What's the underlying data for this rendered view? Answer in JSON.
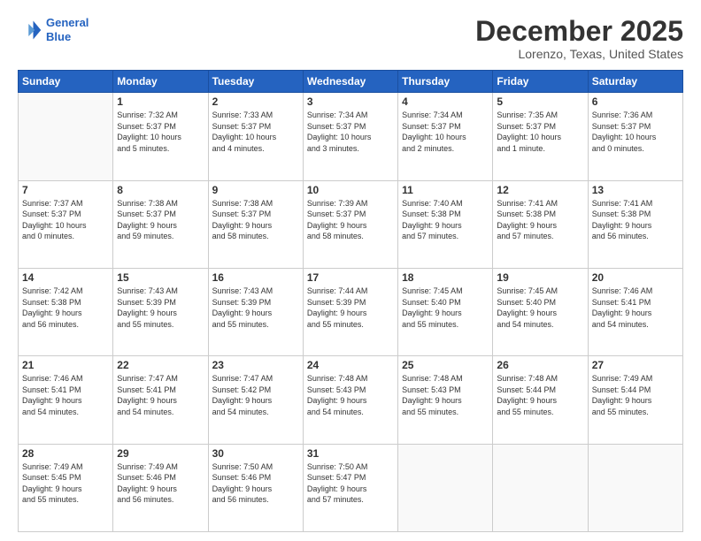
{
  "logo": {
    "line1": "General",
    "line2": "Blue"
  },
  "header": {
    "month": "December 2025",
    "location": "Lorenzo, Texas, United States"
  },
  "weekdays": [
    "Sunday",
    "Monday",
    "Tuesday",
    "Wednesday",
    "Thursday",
    "Friday",
    "Saturday"
  ],
  "weeks": [
    [
      {
        "day": "",
        "info": ""
      },
      {
        "day": "1",
        "info": "Sunrise: 7:32 AM\nSunset: 5:37 PM\nDaylight: 10 hours\nand 5 minutes."
      },
      {
        "day": "2",
        "info": "Sunrise: 7:33 AM\nSunset: 5:37 PM\nDaylight: 10 hours\nand 4 minutes."
      },
      {
        "day": "3",
        "info": "Sunrise: 7:34 AM\nSunset: 5:37 PM\nDaylight: 10 hours\nand 3 minutes."
      },
      {
        "day": "4",
        "info": "Sunrise: 7:34 AM\nSunset: 5:37 PM\nDaylight: 10 hours\nand 2 minutes."
      },
      {
        "day": "5",
        "info": "Sunrise: 7:35 AM\nSunset: 5:37 PM\nDaylight: 10 hours\nand 1 minute."
      },
      {
        "day": "6",
        "info": "Sunrise: 7:36 AM\nSunset: 5:37 PM\nDaylight: 10 hours\nand 0 minutes."
      }
    ],
    [
      {
        "day": "7",
        "info": "Sunrise: 7:37 AM\nSunset: 5:37 PM\nDaylight: 10 hours\nand 0 minutes."
      },
      {
        "day": "8",
        "info": "Sunrise: 7:38 AM\nSunset: 5:37 PM\nDaylight: 9 hours\nand 59 minutes."
      },
      {
        "day": "9",
        "info": "Sunrise: 7:38 AM\nSunset: 5:37 PM\nDaylight: 9 hours\nand 58 minutes."
      },
      {
        "day": "10",
        "info": "Sunrise: 7:39 AM\nSunset: 5:37 PM\nDaylight: 9 hours\nand 58 minutes."
      },
      {
        "day": "11",
        "info": "Sunrise: 7:40 AM\nSunset: 5:38 PM\nDaylight: 9 hours\nand 57 minutes."
      },
      {
        "day": "12",
        "info": "Sunrise: 7:41 AM\nSunset: 5:38 PM\nDaylight: 9 hours\nand 57 minutes."
      },
      {
        "day": "13",
        "info": "Sunrise: 7:41 AM\nSunset: 5:38 PM\nDaylight: 9 hours\nand 56 minutes."
      }
    ],
    [
      {
        "day": "14",
        "info": "Sunrise: 7:42 AM\nSunset: 5:38 PM\nDaylight: 9 hours\nand 56 minutes."
      },
      {
        "day": "15",
        "info": "Sunrise: 7:43 AM\nSunset: 5:39 PM\nDaylight: 9 hours\nand 55 minutes."
      },
      {
        "day": "16",
        "info": "Sunrise: 7:43 AM\nSunset: 5:39 PM\nDaylight: 9 hours\nand 55 minutes."
      },
      {
        "day": "17",
        "info": "Sunrise: 7:44 AM\nSunset: 5:39 PM\nDaylight: 9 hours\nand 55 minutes."
      },
      {
        "day": "18",
        "info": "Sunrise: 7:45 AM\nSunset: 5:40 PM\nDaylight: 9 hours\nand 55 minutes."
      },
      {
        "day": "19",
        "info": "Sunrise: 7:45 AM\nSunset: 5:40 PM\nDaylight: 9 hours\nand 54 minutes."
      },
      {
        "day": "20",
        "info": "Sunrise: 7:46 AM\nSunset: 5:41 PM\nDaylight: 9 hours\nand 54 minutes."
      }
    ],
    [
      {
        "day": "21",
        "info": "Sunrise: 7:46 AM\nSunset: 5:41 PM\nDaylight: 9 hours\nand 54 minutes."
      },
      {
        "day": "22",
        "info": "Sunrise: 7:47 AM\nSunset: 5:41 PM\nDaylight: 9 hours\nand 54 minutes."
      },
      {
        "day": "23",
        "info": "Sunrise: 7:47 AM\nSunset: 5:42 PM\nDaylight: 9 hours\nand 54 minutes."
      },
      {
        "day": "24",
        "info": "Sunrise: 7:48 AM\nSunset: 5:43 PM\nDaylight: 9 hours\nand 54 minutes."
      },
      {
        "day": "25",
        "info": "Sunrise: 7:48 AM\nSunset: 5:43 PM\nDaylight: 9 hours\nand 55 minutes."
      },
      {
        "day": "26",
        "info": "Sunrise: 7:48 AM\nSunset: 5:44 PM\nDaylight: 9 hours\nand 55 minutes."
      },
      {
        "day": "27",
        "info": "Sunrise: 7:49 AM\nSunset: 5:44 PM\nDaylight: 9 hours\nand 55 minutes."
      }
    ],
    [
      {
        "day": "28",
        "info": "Sunrise: 7:49 AM\nSunset: 5:45 PM\nDaylight: 9 hours\nand 55 minutes."
      },
      {
        "day": "29",
        "info": "Sunrise: 7:49 AM\nSunset: 5:46 PM\nDaylight: 9 hours\nand 56 minutes."
      },
      {
        "day": "30",
        "info": "Sunrise: 7:50 AM\nSunset: 5:46 PM\nDaylight: 9 hours\nand 56 minutes."
      },
      {
        "day": "31",
        "info": "Sunrise: 7:50 AM\nSunset: 5:47 PM\nDaylight: 9 hours\nand 57 minutes."
      },
      {
        "day": "",
        "info": ""
      },
      {
        "day": "",
        "info": ""
      },
      {
        "day": "",
        "info": ""
      }
    ]
  ]
}
